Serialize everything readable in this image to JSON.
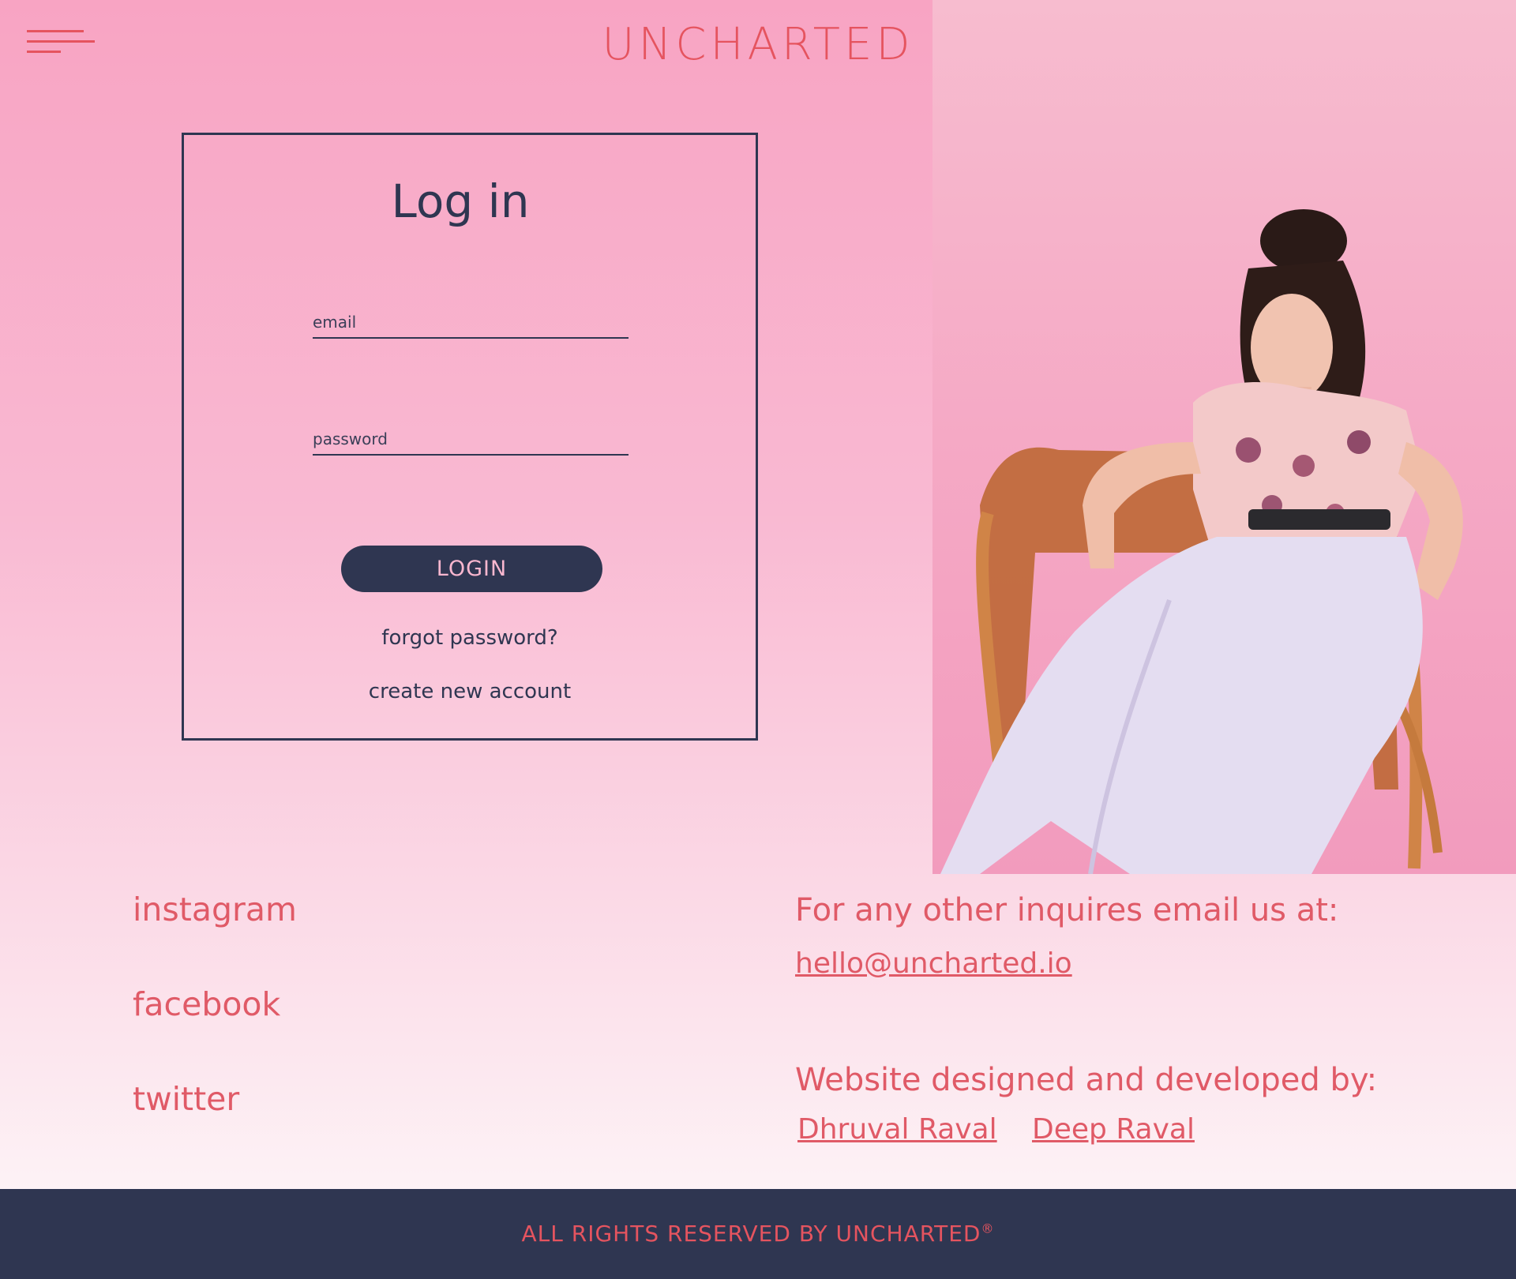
{
  "header": {
    "logo": "UNCHARTED"
  },
  "login": {
    "title": "Log in",
    "email_placeholder": "email",
    "password_placeholder": "password",
    "button_label": "LOGIN",
    "forgot_label": "forgot password?",
    "create_label": "create new account"
  },
  "social": {
    "items": [
      {
        "label": "instagram"
      },
      {
        "label": "facebook"
      },
      {
        "label": "twitter"
      }
    ]
  },
  "contact": {
    "inquiry_heading": "For any other inquires email us at:",
    "email": "hello@uncharted.io",
    "credits_heading": "Website designed and developed by:",
    "developers": [
      {
        "name": "Dhruval Raval"
      },
      {
        "name": "Deep Raval"
      }
    ]
  },
  "footer": {
    "text": "ALL RIGHTS RESERVED BY UNCHARTED",
    "mark": "®"
  },
  "colors": {
    "accent": "#e5545f",
    "navy": "#2f3651",
    "pink_bg": "#f8a4c3"
  },
  "icons": {
    "menu": "hamburger-menu-icon",
    "user": "user-icon"
  }
}
